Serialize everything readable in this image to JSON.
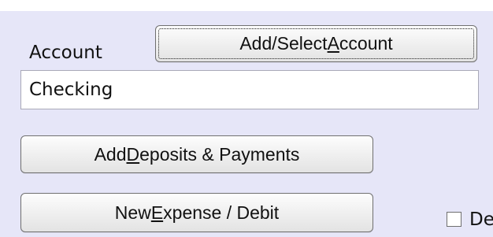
{
  "account": {
    "label": "Account",
    "select_button": {
      "text_before": "Add/Select ",
      "mnemonic": "A",
      "text_after": "ccount"
    },
    "field_value": "Checking"
  },
  "deposits_button": {
    "text_before": "Add ",
    "mnemonic": "D",
    "text_after": "eposits & Payments"
  },
  "expense_button": {
    "text_before": "New ",
    "mnemonic": "E",
    "text_after": "xpense / Debit"
  },
  "checkbox": {
    "checked": false,
    "label_visible": "De"
  },
  "colors": {
    "panel_background": "#e6e6f8",
    "field_background": "#ffffff"
  }
}
